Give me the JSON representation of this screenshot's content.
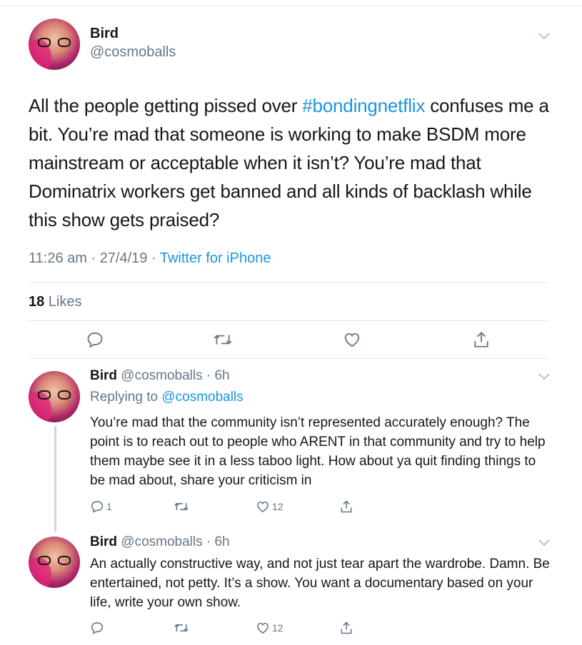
{
  "main_tweet": {
    "name": "Bird",
    "handle": "@cosmoballs",
    "text_before": "All the people getting pissed over ",
    "hashtag": "#bondingnetflix",
    "text_after": " confuses me a bit. You’re mad that someone is working to make BSDM more mainstream or acceptable when it isn’t? You’re mad that Dominatrix workers get banned and all kinds of backlash while this show gets praised?",
    "time": "11:26 am · 27/4/19 · ",
    "source": "Twitter for iPhone",
    "likes_count": "18",
    "likes_label": " Likes"
  },
  "replies": [
    {
      "name": "Bird",
      "handle_time": " @cosmoballs · 6h",
      "replying_label": "Replying to ",
      "replying_to": "@cosmoballs",
      "text": "You’re mad that the community isn’t represented accurately enough? The point is to reach out to people who ARENT in that community and try to help them maybe see it in a less taboo light. How about ya quit finding things to be mad about, share your criticism in",
      "reply_count": "1",
      "like_count": "12"
    },
    {
      "name": "Bird",
      "handle_time": " @cosmoballs · 6h",
      "text": "An actually constructive way, and not  just tear apart the wardrobe. Damn. Be entertained, not petty. It’s a show. You want a documentary based on your life, write your own show.",
      "like_count": "12"
    }
  ],
  "icons": [
    "reply-icon",
    "retweet-icon",
    "like-icon",
    "share-icon",
    "chevron-down-icon"
  ],
  "colors": {
    "link": "#1b95e0",
    "secondary": "#657786",
    "divider": "#e1e8ed"
  }
}
